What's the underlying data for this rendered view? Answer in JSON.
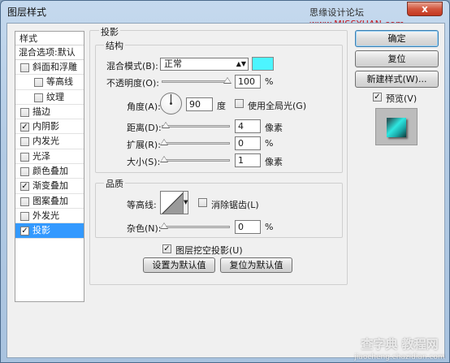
{
  "window": {
    "title": "图层样式",
    "close_symbol": "x"
  },
  "watermark_top": {
    "prefix": "思缘设计论坛 ",
    "site": "www.MISSYUAN.com"
  },
  "style_list": {
    "header": "样式",
    "blend_options": "混合选项:默认",
    "items": [
      {
        "label": "斜面和浮雕",
        "checked": false,
        "indent": false
      },
      {
        "label": "等高线",
        "checked": false,
        "indent": true
      },
      {
        "label": "纹理",
        "checked": false,
        "indent": true
      },
      {
        "label": "描边",
        "checked": false,
        "indent": false
      },
      {
        "label": "内阴影",
        "checked": true,
        "indent": false
      },
      {
        "label": "内发光",
        "checked": false,
        "indent": false
      },
      {
        "label": "光泽",
        "checked": false,
        "indent": false
      },
      {
        "label": "颜色叠加",
        "checked": false,
        "indent": false
      },
      {
        "label": "渐变叠加",
        "checked": true,
        "indent": false
      },
      {
        "label": "图案叠加",
        "checked": false,
        "indent": false
      },
      {
        "label": "外发光",
        "checked": false,
        "indent": false
      },
      {
        "label": "投影",
        "checked": true,
        "indent": false,
        "selected": true
      }
    ]
  },
  "buttons": {
    "ok": "确定",
    "reset": "复位",
    "new_style": "新建样式(W)...",
    "preview": "预览(V)",
    "preview_checked": true
  },
  "panel": {
    "title": "投影",
    "structure": {
      "title": "结构",
      "blend_mode_label": "混合模式(B):",
      "blend_mode_value": "正常",
      "shadow_color": "#4cf5ff",
      "opacity_label": "不透明度(O):",
      "opacity_value": "100",
      "opacity_unit": "%",
      "opacity_level": 1.0,
      "angle_label": "角度(A):",
      "angle_value": "90",
      "angle_unit": "度",
      "global_light_label": "使用全局光(G)",
      "global_light_checked": false,
      "distance_label": "距离(D):",
      "distance_value": "4",
      "distance_unit": "像素",
      "distance_level": 0.02,
      "spread_label": "扩展(R):",
      "spread_value": "0",
      "spread_unit": "%",
      "spread_level": 0.0,
      "size_label": "大小(S):",
      "size_value": "1",
      "size_unit": "像素",
      "size_level": 0.0
    },
    "quality": {
      "title": "品质",
      "contour_label": "等高线:",
      "antialias_label": "消除锯齿(L)",
      "antialias_checked": false,
      "noise_label": "杂色(N):",
      "noise_value": "0",
      "noise_unit": "%",
      "noise_level": 0.0
    },
    "knockout_label": "图层挖空投影(U)",
    "knockout_checked": true,
    "make_default": "设置为默认值",
    "reset_default": "复位为默认值"
  },
  "watermark_bottom": {
    "line1": "查字典 教程网",
    "line2": "jiaocheng.chazidian.com"
  }
}
